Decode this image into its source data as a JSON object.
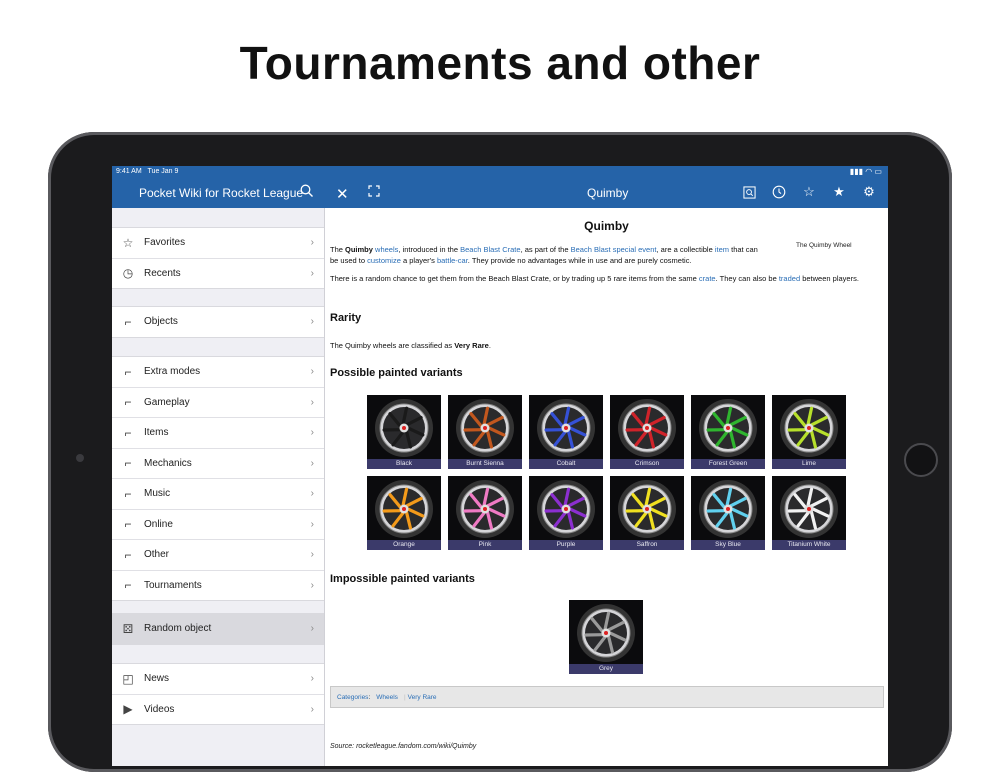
{
  "headline": "Tournaments and other",
  "status": {
    "time": "9:41 AM",
    "date": "Tue Jan 9"
  },
  "sidebar": {
    "title": "Pocket Wiki for Rocket League",
    "groups": [
      [
        {
          "label": "Favorites",
          "icon": "star-icon"
        },
        {
          "label": "Recents",
          "icon": "clock-icon"
        }
      ],
      [
        {
          "label": "Objects",
          "icon": "car-icon"
        }
      ],
      [
        {
          "label": "Extra modes",
          "icon": "car-icon"
        },
        {
          "label": "Gameplay",
          "icon": "car-icon"
        },
        {
          "label": "Items",
          "icon": "car-icon"
        },
        {
          "label": "Mechanics",
          "icon": "car-icon"
        },
        {
          "label": "Music",
          "icon": "car-icon"
        },
        {
          "label": "Online",
          "icon": "car-icon"
        },
        {
          "label": "Other",
          "icon": "car-icon"
        },
        {
          "label": "Tournaments",
          "icon": "car-icon"
        }
      ],
      [
        {
          "label": "Random object",
          "icon": "dice-icon",
          "selected": true
        }
      ],
      [
        {
          "label": "News",
          "icon": "rss-icon"
        },
        {
          "label": "Videos",
          "icon": "play-icon"
        }
      ]
    ]
  },
  "page": {
    "nav_title": "Quimby",
    "title": "Quimby",
    "infobox_caption": "The Quimby Wheel",
    "intro": {
      "t1": "The ",
      "b1": "Quimby",
      "l1": "wheels",
      "t2": ", introduced in the ",
      "l2": "Beach Blast Crate",
      "t3": ", as part of the ",
      "l3": "Beach Blast special event",
      "t4": ", are a collectible ",
      "l4": "item",
      "t5": " that can be used to ",
      "l5": "customize",
      "t6": " a player's ",
      "l6": "battle-car",
      "t7": ". They provide no advantages while in use and are purely cosmetic."
    },
    "random": {
      "t1": "There is a random chance to get them from the Beach Blast Crate, or by trading up 5 rare items from the same ",
      "l1": "crate",
      "t2": ". They can also be ",
      "l2": "traded",
      "t3": " between players."
    },
    "rarity_heading": "Rarity",
    "rarity_text": "The Quimby wheels are classified as ",
    "rarity_value": "Very Rare",
    "rarity_end": ".",
    "possible_heading": "Possible painted variants",
    "variants": [
      {
        "name": "Black",
        "color": "#1a1a1a"
      },
      {
        "name": "Burnt Sienna",
        "color": "#c2571e"
      },
      {
        "name": "Cobalt",
        "color": "#3551d6"
      },
      {
        "name": "Crimson",
        "color": "#d0232a"
      },
      {
        "name": "Forest Green",
        "color": "#2fb52f"
      },
      {
        "name": "Lime",
        "color": "#b7e02b"
      },
      {
        "name": "Orange",
        "color": "#f39a1a"
      },
      {
        "name": "Pink",
        "color": "#f07ac4"
      },
      {
        "name": "Purple",
        "color": "#8c2fd0"
      },
      {
        "name": "Saffron",
        "color": "#f0e020"
      },
      {
        "name": "Sky Blue",
        "color": "#60d0ee"
      },
      {
        "name": "Titanium White",
        "color": "#f2f2f2"
      }
    ],
    "impossible_heading": "Impossible painted variants",
    "impossible": [
      {
        "name": "Grey",
        "color": "#9a9a9a"
      }
    ],
    "categories_label": "Categories",
    "categories": [
      "Wheels",
      "Very Rare"
    ],
    "source": "Source: rocketleague.fandom.com/wiki/Quimby"
  }
}
